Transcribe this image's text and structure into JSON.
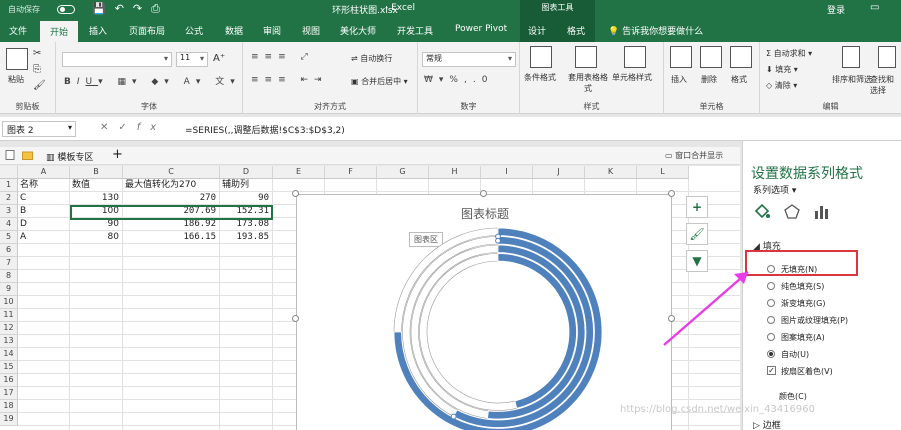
{
  "window": {
    "autosave": "自动保存",
    "file_name": "环形柱状图.xlsx",
    "app_name": "Excel",
    "context_group": "图表工具",
    "login": "登录"
  },
  "tabs": [
    "文件",
    "开始",
    "插入",
    "页面布局",
    "公式",
    "数据",
    "审阅",
    "视图",
    "美化大师",
    "开发工具",
    "Power Pivot",
    "设计",
    "格式"
  ],
  "active_tab": "开始",
  "tell_me": "告诉我你想要做什么",
  "ribbon": {
    "groups": [
      "剪贴板",
      "字体",
      "对齐方式",
      "数字",
      "样式",
      "单元格",
      "编辑"
    ],
    "paste": "粘贴",
    "font_size": "11",
    "wrap_text": "自动换行",
    "merge_center": "合并后居中",
    "number_format": "常规",
    "conditional_format": "条件格式",
    "table_format": "套用表格格式",
    "cell_styles": "单元格样式",
    "insert": "插入",
    "delete": "删除",
    "format": "格式",
    "autosum": "自动求和",
    "fill": "填充",
    "clear": "清除",
    "sort_filter": "排序和筛选",
    "find_select": "查找和选择"
  },
  "formula_bar": {
    "name_box": "图表 2",
    "formula": "=SERIES(,,调整后数据!$C$3:$D$3,2)"
  },
  "workbook_strip": {
    "template": "模板专区",
    "merge_label": "窗口合并显示"
  },
  "columns": [
    "A",
    "B",
    "C",
    "D",
    "E",
    "F",
    "G",
    "H",
    "I",
    "J",
    "K",
    "L"
  ],
  "rows": [
    "1",
    "2",
    "3",
    "4",
    "5",
    "6",
    "7",
    "8",
    "9",
    "10",
    "11",
    "12",
    "13",
    "14",
    "15",
    "16",
    "17",
    "18",
    "19"
  ],
  "table": {
    "headers": [
      "名称",
      "数值",
      "最大值转化为270",
      "辅助列"
    ],
    "data": [
      [
        "C",
        "130",
        "270",
        "90"
      ],
      [
        "B",
        "100",
        "207.69",
        "152.31"
      ],
      [
        "D",
        "90",
        "186.92",
        "173.08"
      ],
      [
        "A",
        "80",
        "166.15",
        "193.85"
      ]
    ]
  },
  "chart": {
    "title": "图表标题",
    "tooltip": "图表区"
  },
  "chart_data": {
    "type": "doughnut",
    "title": "图表标题",
    "rings": [
      {
        "category": "C",
        "value": 270,
        "helper": 90
      },
      {
        "category": "B",
        "value": 207.69,
        "helper": 152.31
      },
      {
        "category": "D",
        "value": 186.92,
        "helper": 173.08
      },
      {
        "category": "A",
        "value": 166.15,
        "helper": 193.85
      }
    ],
    "fill_color": "#4f81bd"
  },
  "pane": {
    "title": "设置数据系列格式",
    "subtitle": "系列选项",
    "section": "填充",
    "options": [
      {
        "label": "无填充(N)",
        "type": "radio",
        "checked": false
      },
      {
        "label": "纯色填充(S)",
        "type": "radio",
        "checked": false
      },
      {
        "label": "渐变填充(G)",
        "type": "radio",
        "checked": false
      },
      {
        "label": "图片或纹理填充(P)",
        "type": "radio",
        "checked": false
      },
      {
        "label": "图案填充(A)",
        "type": "radio",
        "checked": false
      },
      {
        "label": "自动(U)",
        "type": "radio",
        "checked": true
      },
      {
        "label": "按扇区着色(V)",
        "type": "checkbox",
        "checked": true
      }
    ],
    "color_label": "颜色(C)",
    "border_label": "边框"
  },
  "watermark": "https://blog.csdn.net/weixin_43416960",
  "colors": {
    "excel_green": "#217346",
    "highlight_red": "#d9363e",
    "arrow_magenta": "#e83ce8"
  }
}
